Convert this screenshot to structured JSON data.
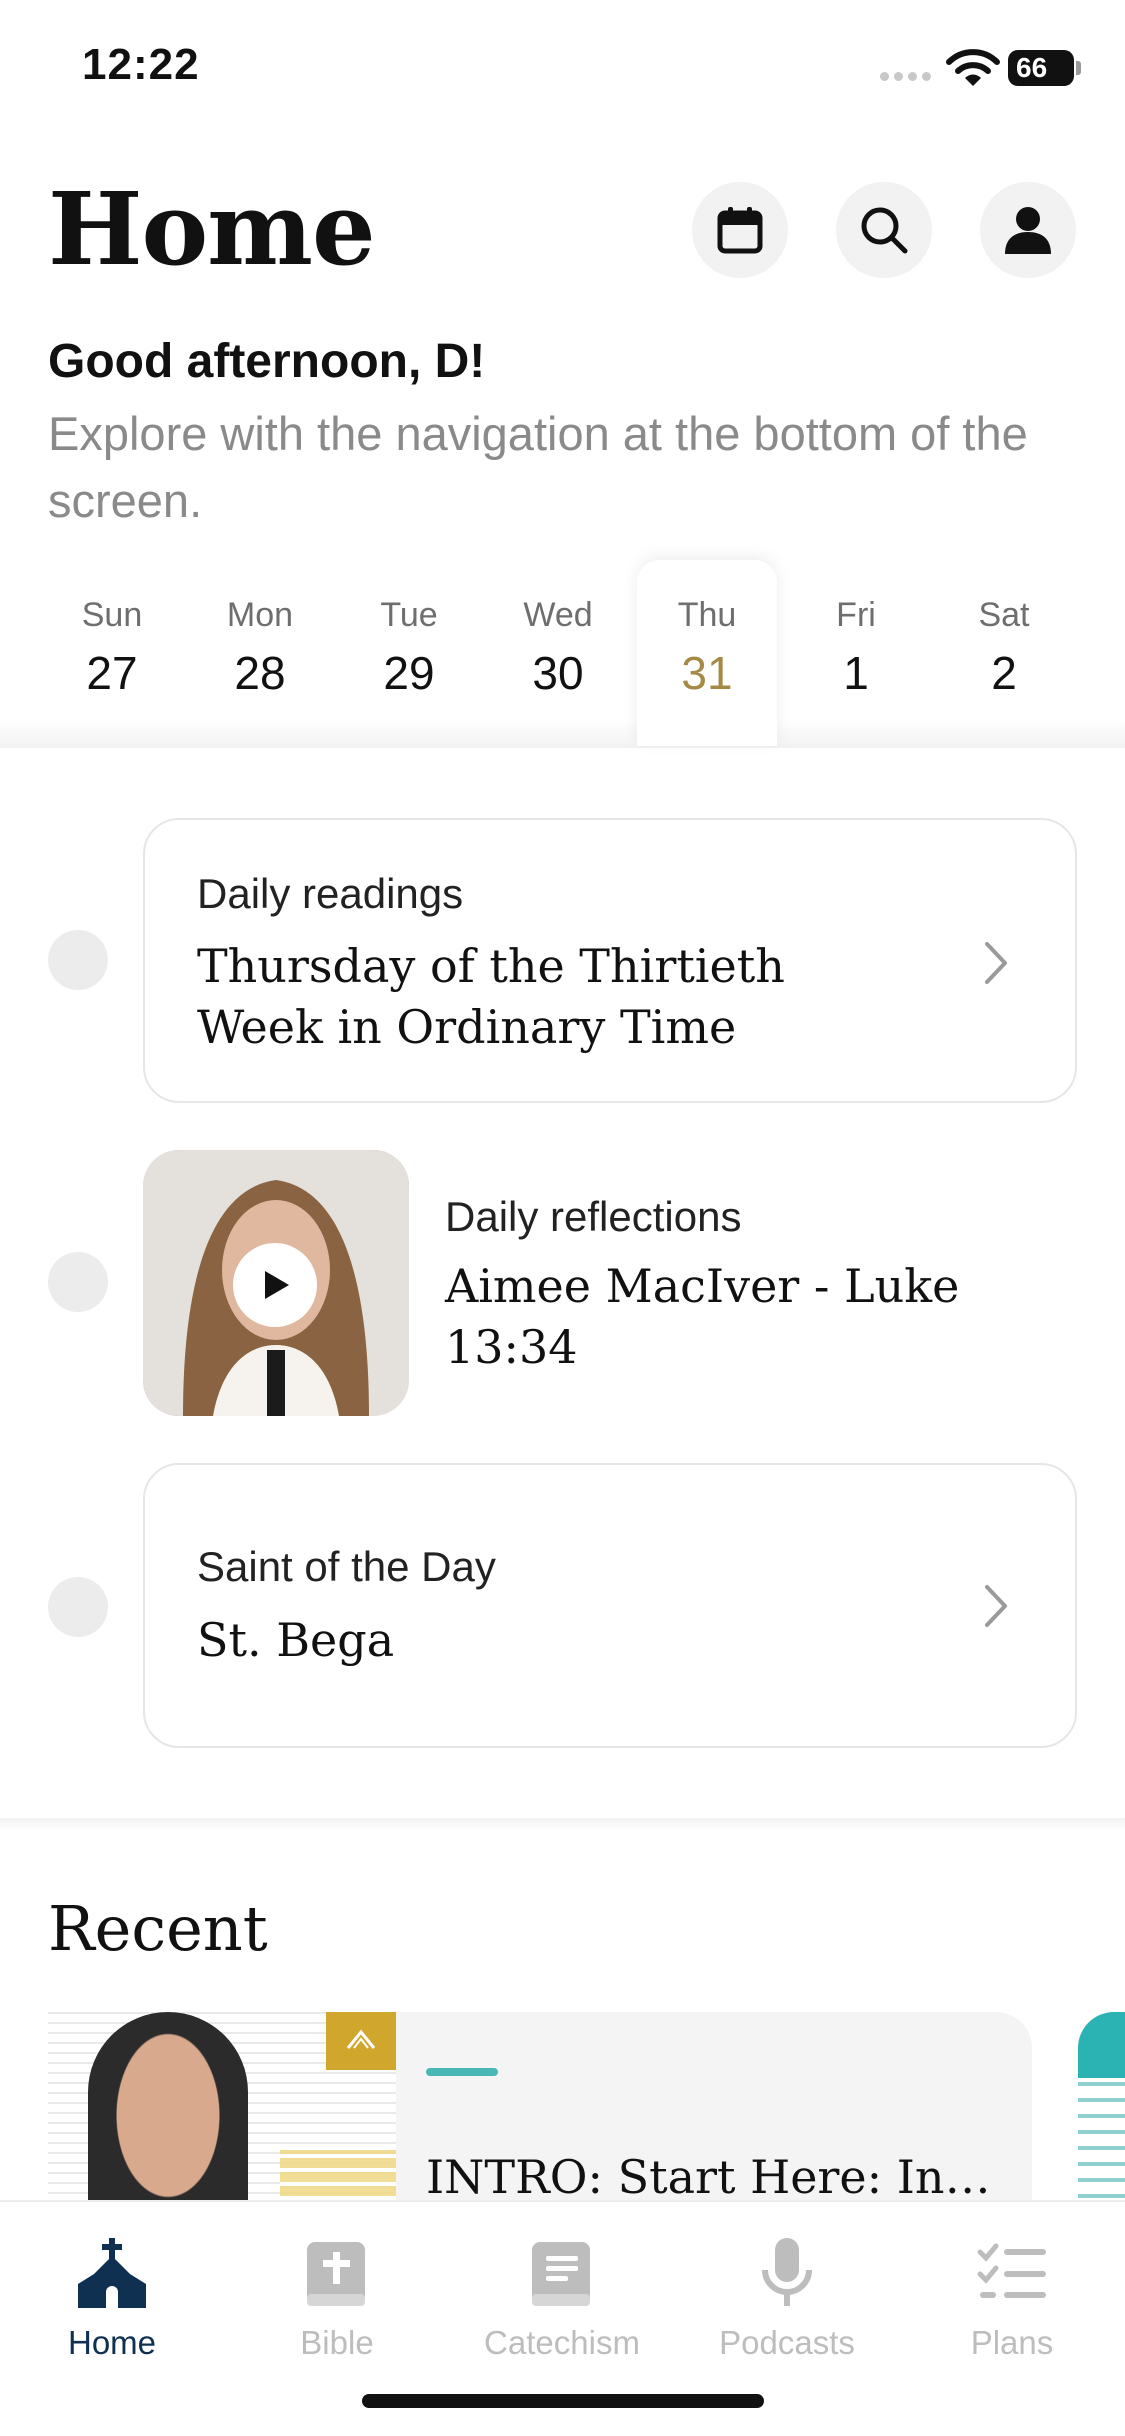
{
  "status_bar": {
    "time": "12:22",
    "battery": "66"
  },
  "header": {
    "title": "Home"
  },
  "greeting": {
    "title": "Good afternoon, D!",
    "subtitle": "Explore with the navigation at the bottom of the screen."
  },
  "week": [
    {
      "day": "Sun",
      "date": "27"
    },
    {
      "day": "Mon",
      "date": "28"
    },
    {
      "day": "Tue",
      "date": "29"
    },
    {
      "day": "Wed",
      "date": "30"
    },
    {
      "day": "Thu",
      "date": "31"
    },
    {
      "day": "Fri",
      "date": "1"
    },
    {
      "day": "Sat",
      "date": "2"
    }
  ],
  "selected_day": "Thu",
  "daily_readings": {
    "label": "Daily readings",
    "title": "Thursday of the Thirtieth Week in Ordinary Time"
  },
  "daily_reflections": {
    "label": "Daily reflections",
    "title": "Aimee MacIver - Luke 13:34"
  },
  "saint_of_day": {
    "label": "Saint of the Day",
    "title": "St. Bega"
  },
  "recent": {
    "title": "Recent",
    "items": [
      {
        "title": "INTRO: Start Here: Intro..."
      }
    ]
  },
  "tabs": [
    {
      "label": "Home",
      "icon": "church-icon",
      "active": true
    },
    {
      "label": "Bible",
      "icon": "bible-icon",
      "active": false
    },
    {
      "label": "Catechism",
      "icon": "book-icon",
      "active": false
    },
    {
      "label": "Podcasts",
      "icon": "microphone-icon",
      "active": false
    },
    {
      "label": "Plans",
      "icon": "checklist-icon",
      "active": false
    }
  ],
  "colors": {
    "accent_gold": "#a58a46",
    "tab_active": "#0f3050",
    "tab_inactive": "#bdbdbd",
    "teal": "#49b7b6"
  }
}
